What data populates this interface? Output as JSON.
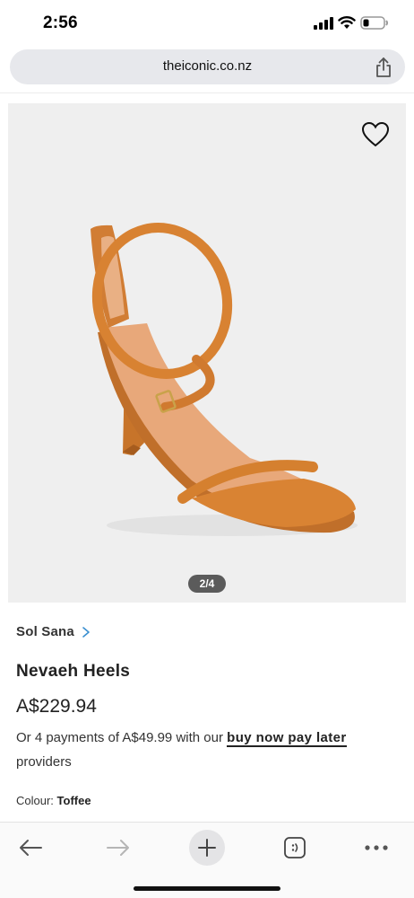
{
  "status_bar": {
    "time": "2:56",
    "icons": [
      "signal-icon",
      "wifi-icon",
      "battery-icon"
    ]
  },
  "browser": {
    "url": "theiconic.co.nz",
    "share_icon": "share-icon"
  },
  "product": {
    "image_pager": "2/4",
    "wishlist_icon": "heart-icon",
    "brand": "Sol Sana",
    "name": "Nevaeh Heels",
    "price": "A$229.94",
    "installments_prefix": "Or 4 payments of A$49.99 with our ",
    "installments_link": "buy now pay later",
    "installments_suffix": " providers",
    "colour_label": "Colour:",
    "colour_value": "Toffee",
    "shoe_color": "#d9822f"
  },
  "toolbar": {
    "items": [
      "back-icon",
      "forward-icon",
      "new-tab-icon",
      "tabs-icon",
      "more-icon"
    ]
  }
}
